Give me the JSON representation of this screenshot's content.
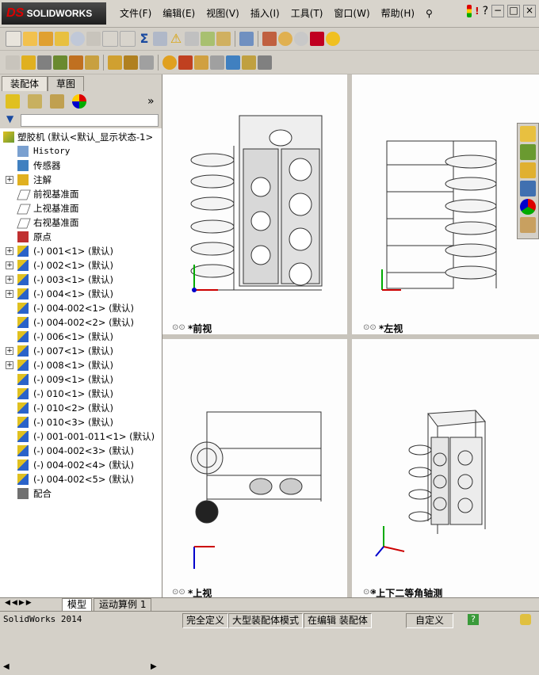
{
  "app": {
    "logo_text": "SOLIDWORKS",
    "logo_prefix": "DS"
  },
  "menu": [
    "文件(F)",
    "编辑(E)",
    "视图(V)",
    "插入(I)",
    "工具(T)",
    "窗口(W)",
    "帮助(H)"
  ],
  "window_controls": [
    "?",
    "−",
    "□",
    "×"
  ],
  "left_tabs": {
    "assembly": "装配体",
    "sketch": "草图"
  },
  "tree": {
    "root": "塑胶机  (默认<默认_显示状态-1>",
    "items": [
      {
        "label": "History",
        "expand": false,
        "icon": "history-icon",
        "mono": true
      },
      {
        "label": "传感器",
        "expand": false,
        "icon": "sensor-icon"
      },
      {
        "label": "注解",
        "expand": true,
        "icon": "annotation-icon"
      },
      {
        "label": "前视基准面",
        "expand": false,
        "icon": "plane-icon"
      },
      {
        "label": "上视基准面",
        "expand": false,
        "icon": "plane-icon"
      },
      {
        "label": "右视基准面",
        "expand": false,
        "icon": "plane-icon"
      },
      {
        "label": "原点",
        "expand": false,
        "icon": "origin-icon"
      },
      {
        "label": "(-) 001<1> (默认)",
        "expand": true,
        "icon": "part-icon"
      },
      {
        "label": "(-) 002<1> (默认)",
        "expand": true,
        "icon": "part-icon"
      },
      {
        "label": "(-) 003<1> (默认)",
        "expand": true,
        "icon": "part-icon"
      },
      {
        "label": "(-) 004<1> (默认)",
        "expand": true,
        "icon": "part-icon"
      },
      {
        "label": "(-) 004-002<1> (默认)",
        "expand": false,
        "icon": "part-icon"
      },
      {
        "label": "(-) 004-002<2> (默认)",
        "expand": false,
        "icon": "part-icon"
      },
      {
        "label": "(-) 006<1> (默认)",
        "expand": false,
        "icon": "part-icon"
      },
      {
        "label": "(-) 007<1> (默认)",
        "expand": true,
        "icon": "part-icon"
      },
      {
        "label": "(-) 008<1> (默认)",
        "expand": true,
        "icon": "part-icon"
      },
      {
        "label": "(-) 009<1> (默认)",
        "expand": false,
        "icon": "part-icon"
      },
      {
        "label": "(-) 010<1> (默认)",
        "expand": false,
        "icon": "part-icon"
      },
      {
        "label": "(-) 010<2> (默认)",
        "expand": false,
        "icon": "part-icon"
      },
      {
        "label": "(-) 010<3> (默认)",
        "expand": false,
        "icon": "part-icon"
      },
      {
        "label": "(-) 001-001-011<1> (默认)",
        "expand": false,
        "icon": "part-icon"
      },
      {
        "label": "(-) 004-002<3> (默认)",
        "expand": false,
        "icon": "part-icon"
      },
      {
        "label": "(-) 004-002<4> (默认)",
        "expand": false,
        "icon": "part-icon"
      },
      {
        "label": "(-) 004-002<5> (默认)",
        "expand": false,
        "icon": "part-icon"
      },
      {
        "label": "配合",
        "expand": false,
        "icon": "mates-icon"
      }
    ]
  },
  "viewports": {
    "front": "*前视",
    "left": "*左视",
    "top": "*上视",
    "iso": "*上下二等角轴测"
  },
  "bottom_tabs": {
    "model": "模型",
    "motion": "运动算例 1"
  },
  "status": {
    "app_version": "SolidWorks 2014",
    "defined": "完全定义",
    "mode": "大型装配体模式",
    "editing": "在编辑 装配体",
    "custom": "自定义"
  },
  "colors": {
    "accent": "#c8102e",
    "selection_blue": "#0a246a",
    "tree_part": "#2a62c9"
  }
}
